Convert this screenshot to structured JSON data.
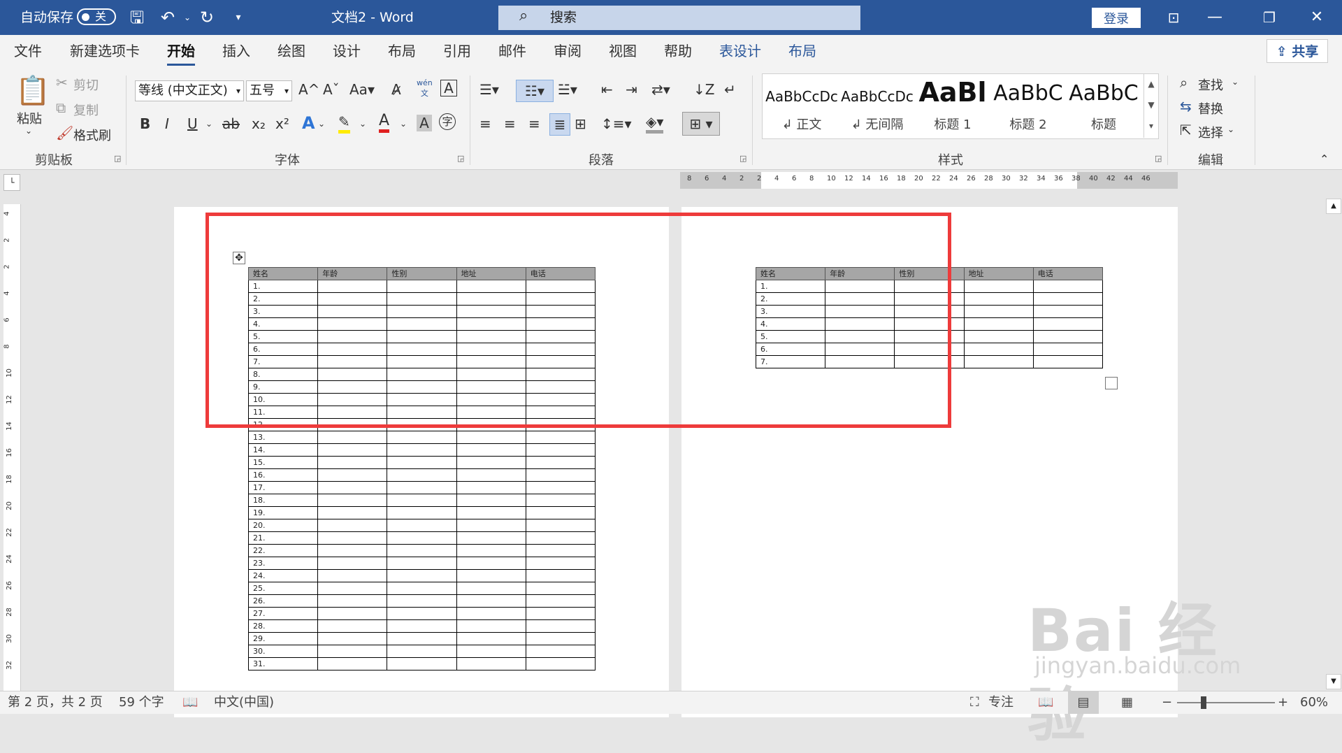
{
  "titlebar": {
    "autosave_label": "自动保存",
    "autosave_state": "关",
    "doc_title": "文档2  -  Word",
    "search_placeholder": "搜索",
    "login": "登录"
  },
  "menu": {
    "tabs": [
      "文件",
      "新建选项卡",
      "开始",
      "插入",
      "绘图",
      "设计",
      "布局",
      "引用",
      "邮件",
      "审阅",
      "视图",
      "帮助",
      "表设计",
      "布局"
    ],
    "active_index": 2,
    "share": "共享"
  },
  "ribbon": {
    "clipboard": {
      "paste": "粘贴",
      "cut": "剪切",
      "copy": "复制",
      "format_painter": "格式刷",
      "label": "剪贴板"
    },
    "font": {
      "font_name": "等线 (中文正文)",
      "font_size": "五号",
      "label": "字体",
      "phonetic": "wén"
    },
    "paragraph": {
      "label": "段落"
    },
    "styles": {
      "items": [
        {
          "preview": "AaBbCcDc",
          "name": "↲ 正文"
        },
        {
          "preview": "AaBbCcDc",
          "name": "↲ 无间隔"
        },
        {
          "preview": "AaBl",
          "name": "标题 1"
        },
        {
          "preview": "AaBbC",
          "name": "标题 2"
        },
        {
          "preview": "AaBbC",
          "name": "标题"
        }
      ],
      "label": "样式"
    },
    "editing": {
      "find": "查找",
      "replace": "替换",
      "select": "选择",
      "label": "编辑"
    }
  },
  "ruler": {
    "h_numbers": [
      "8",
      "6",
      "4",
      "2",
      "2",
      "4",
      "6",
      "8",
      "10",
      "12",
      "14",
      "16",
      "18",
      "20",
      "22",
      "24",
      "26",
      "28",
      "30",
      "32",
      "34",
      "36",
      "38",
      "40",
      "42",
      "44",
      "46"
    ],
    "v_numbers": [
      "4",
      "2",
      "2",
      "4",
      "6",
      "8",
      "10",
      "12",
      "14",
      "16",
      "18",
      "20",
      "22",
      "24",
      "26",
      "28",
      "30",
      "32"
    ]
  },
  "table": {
    "headers": [
      "姓名",
      "年龄",
      "性别",
      "地址",
      "电话"
    ],
    "page1_rows": [
      "1.",
      "2.",
      "3.",
      "4.",
      "5.",
      "6.",
      "7.",
      "8.",
      "9.",
      "10.",
      "11.",
      "12.",
      "13.",
      "14.",
      "15.",
      "16.",
      "17.",
      "18.",
      "19.",
      "20.",
      "21.",
      "22.",
      "23.",
      "24.",
      "25.",
      "26.",
      "27.",
      "28.",
      "29.",
      "30.",
      "31."
    ],
    "page2_rows": [
      "1.",
      "2.",
      "3.",
      "4.",
      "5.",
      "6.",
      "7."
    ]
  },
  "statusbar": {
    "page": "第 2 页，共 2 页",
    "words": "59 个字",
    "language": "中文(中国)",
    "focus": "专注",
    "zoom": "60%"
  },
  "watermark": {
    "logo": "Bai 经验",
    "url": "jingyan.baidu.com"
  },
  "colors": {
    "title_bg": "#2b579a",
    "highlight_box": "#ee3b3b",
    "table_header": "#a6a6a6"
  }
}
